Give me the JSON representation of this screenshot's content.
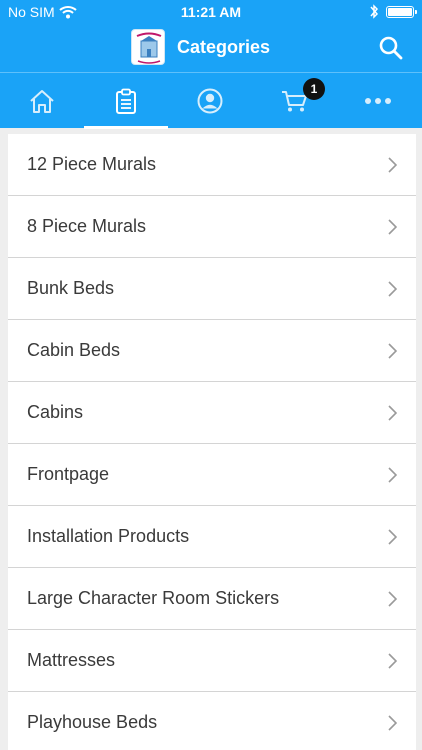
{
  "status_bar": {
    "carrier": "No SIM",
    "time": "11:21 AM"
  },
  "header": {
    "title": "Categories"
  },
  "tabs": [
    {
      "icon": "home-icon",
      "active": false
    },
    {
      "icon": "clipboard-icon",
      "active": true
    },
    {
      "icon": "account-icon",
      "active": false
    },
    {
      "icon": "cart-icon",
      "active": false,
      "badge": "1"
    },
    {
      "icon": "more-icon",
      "active": false
    }
  ],
  "categories": [
    "12 Piece Murals",
    "8 Piece Murals",
    "Bunk Beds",
    "Cabin Beds",
    "Cabins",
    "Frontpage",
    "Installation Products",
    "Large Character Room Stickers",
    "Mattresses",
    "Playhouse Beds"
  ],
  "colors": {
    "brand": "#1aa3f7",
    "list_text": "#3a3a3a",
    "badge": "#111111"
  }
}
